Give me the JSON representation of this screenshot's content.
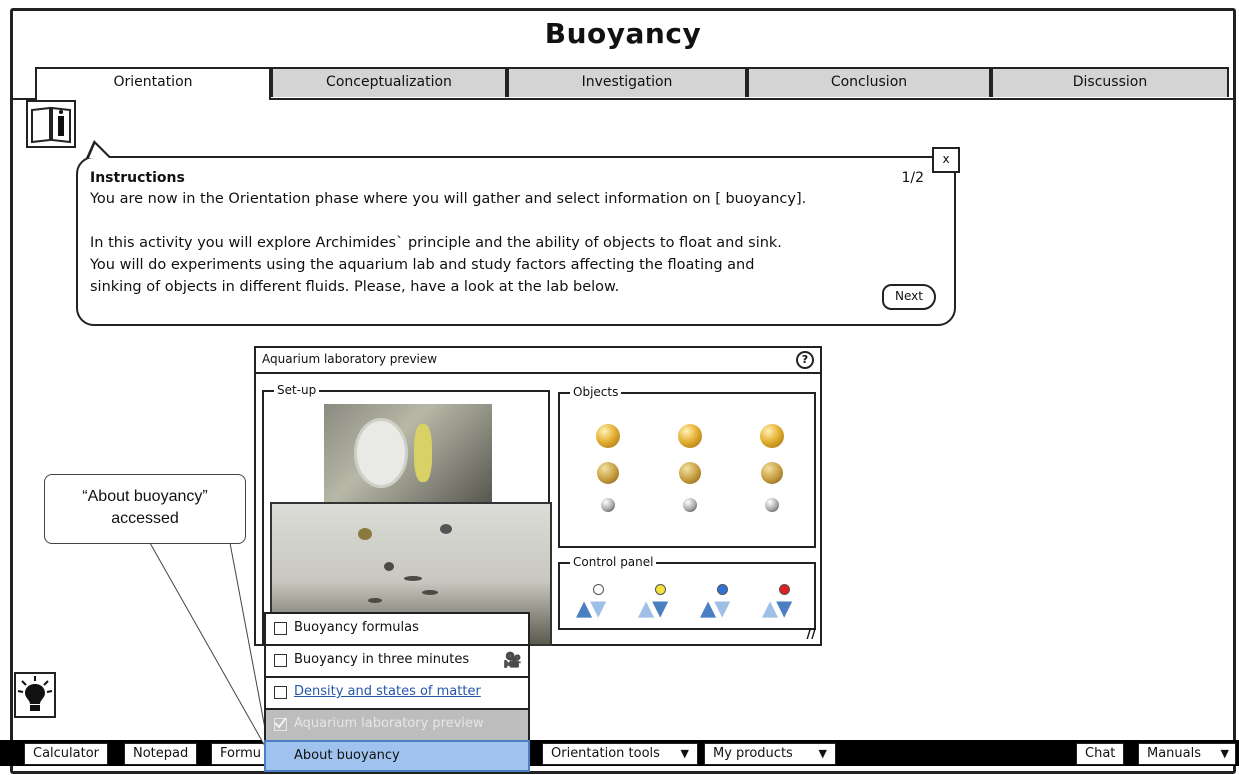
{
  "app": {
    "title": "Buoyancy"
  },
  "tabs": [
    {
      "label": "Orientation",
      "active": true
    },
    {
      "label": "Conceptualization",
      "active": false
    },
    {
      "label": "Investigation",
      "active": false
    },
    {
      "label": "Conclusion",
      "active": false
    },
    {
      "label": "Discussion",
      "active": false
    }
  ],
  "instructions": {
    "heading": "Instructions",
    "page": "1/2",
    "text": "You are now in the Orientation phase where you will gather and select information on [ buoyancy].\n\nIn this activity you will explore Archimides` principle and the ability of objects to float and sink.\nYou will do experiments using the aquarium lab and study factors affecting the floating and\nsinking of objects in different fluids. Please, have a look at the lab below.",
    "close_label": "x",
    "next_label": "Next"
  },
  "lab": {
    "title": "Aquarium laboratory preview",
    "help_label": "?",
    "setup_label": "Set-up",
    "objects_label": "Objects",
    "control_label": "Control panel",
    "resize_label": "//",
    "control_colors": [
      "#ffffff",
      "#f2e23a",
      "#2f73d8",
      "#e02020"
    ]
  },
  "callout": {
    "text": "“About buoyancy”\naccessed"
  },
  "menu": {
    "items": [
      {
        "label": "Buoyancy formulas",
        "state": "normal"
      },
      {
        "label": "Buoyancy in three minutes",
        "state": "normal",
        "icon": "film-camera-icon"
      },
      {
        "label": "Density and states of matter",
        "state": "link"
      },
      {
        "label": "Aquarium laboratory preview",
        "state": "disabled",
        "checked": true
      },
      {
        "label": "About buoyancy",
        "state": "selected"
      }
    ]
  },
  "bottombar": {
    "calculator": "Calculator",
    "notepad": "Notepad",
    "formulas": "Formu",
    "orientation_tools": "Orientation tools",
    "my_products": "My products",
    "chat": "Chat",
    "manuals": "Manuals"
  }
}
